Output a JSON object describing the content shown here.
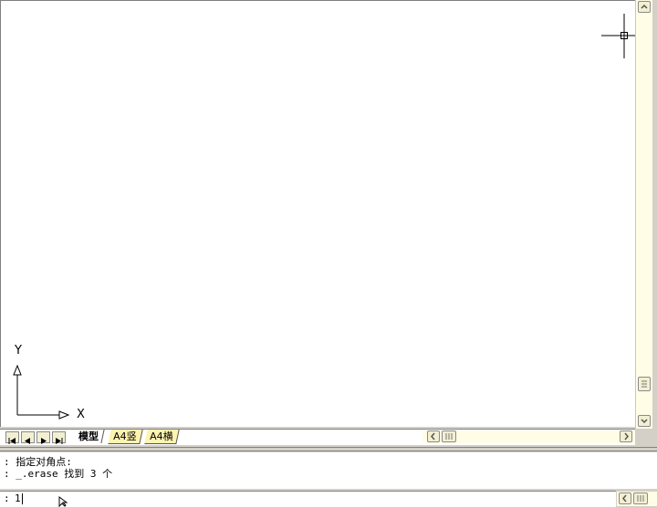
{
  "drawing_area": {
    "ucs_icon": {
      "x_label": "X",
      "y_label": "Y"
    }
  },
  "layout_tabs": {
    "nav_buttons": [
      "first-tab-icon",
      "prev-tab-icon",
      "next-tab-icon",
      "last-tab-icon"
    ],
    "tabs": [
      {
        "label": "模型",
        "active": true
      },
      {
        "label": "A4竖",
        "active": false
      },
      {
        "label": "A4横",
        "active": false
      }
    ]
  },
  "command_window": {
    "history": [
      {
        "prompt": ":",
        "text": "指定对角点:"
      },
      {
        "prompt": ":",
        "text": "_.erase 找到 3 个"
      }
    ],
    "input": {
      "prompt": ":",
      "value": "1"
    }
  },
  "colors": {
    "canvas": "#ffffff",
    "scrollbar_track": "#fffde6",
    "tab_inactive": "#fff3b0",
    "window_chrome": "#d4d0c8"
  }
}
